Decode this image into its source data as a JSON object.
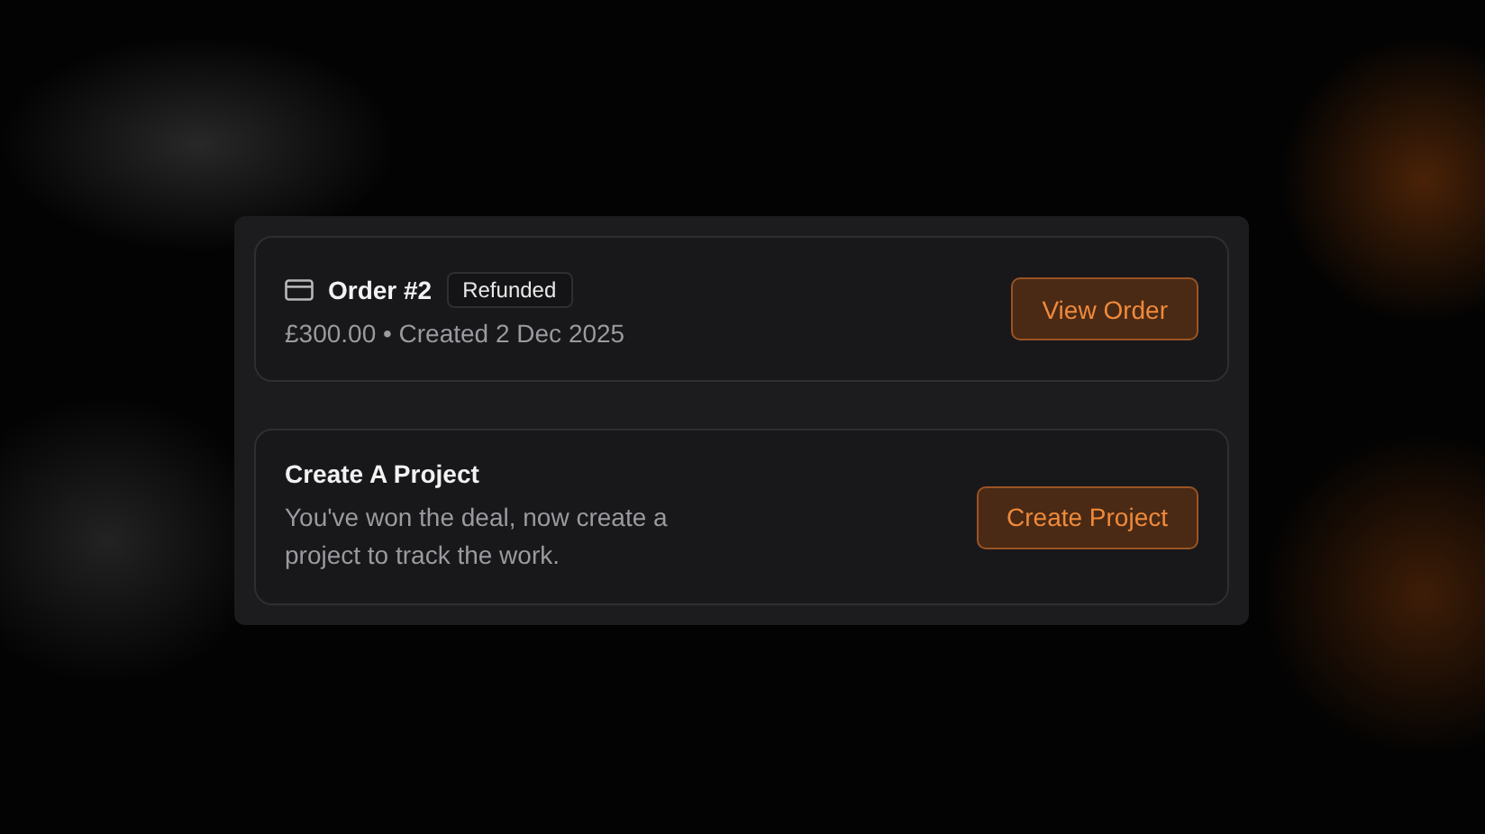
{
  "order": {
    "title": "Order #2",
    "status": "Refunded",
    "meta": "£300.00 • Created 2 Dec 2025",
    "button": "View Order"
  },
  "project": {
    "title": "Create A Project",
    "description": "You've won the deal, now create a project to track the work.",
    "button": "Create Project"
  }
}
